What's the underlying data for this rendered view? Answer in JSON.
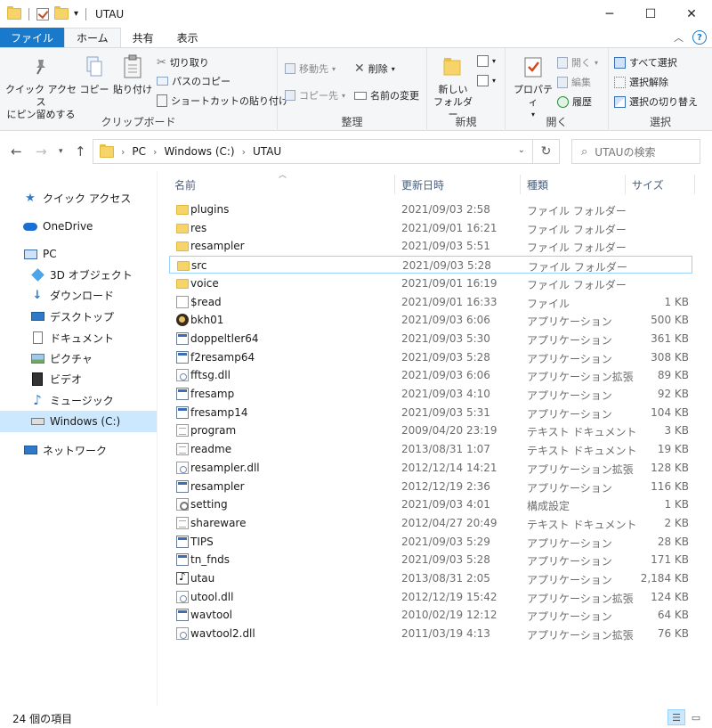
{
  "window": {
    "title": "UTAU"
  },
  "ribbon_tabs": [
    {
      "label": "ファイル"
    },
    {
      "label": "ホーム"
    },
    {
      "label": "共有"
    },
    {
      "label": "表示"
    }
  ],
  "ribbon": {
    "clipboard": {
      "label": "クリップボード",
      "pin": "クイック アクセス\nにピン留めする",
      "pin_line1": "クイック アクセス",
      "pin_line2": "にピン留めする",
      "copy": "コピー",
      "paste": "貼り付け",
      "cut": "切り取り",
      "copy_path": "パスのコピー",
      "paste_shortcut": "ショートカットの貼り付け"
    },
    "organize": {
      "label": "整理",
      "move_to": "移動先",
      "copy_to": "コピー先",
      "delete": "削除",
      "rename": "名前の変更"
    },
    "new": {
      "label": "新規",
      "new_folder_line1": "新しい",
      "new_folder_line2": "フォルダー"
    },
    "open": {
      "label": "開く",
      "properties": "プロパティ",
      "open": "開く",
      "edit": "編集",
      "history": "履歴"
    },
    "select": {
      "label": "選択",
      "select_all": "すべて選択",
      "select_none": "選択解除",
      "invert": "選択の切り替え"
    }
  },
  "address": {
    "crumbs": [
      "PC",
      "Windows (C:)",
      "UTAU"
    ]
  },
  "search": {
    "placeholder": "UTAUの検索"
  },
  "nav_pane": [
    {
      "label": "クイック アクセス",
      "icon": "star-icon"
    },
    {
      "label": "OneDrive",
      "icon": "cloud-icon"
    },
    {
      "label": "PC",
      "icon": "pc-icon"
    },
    {
      "label": "3D オブジェクト",
      "icon": "cube-icon"
    },
    {
      "label": "ダウンロード",
      "icon": "download-icon"
    },
    {
      "label": "デスクトップ",
      "icon": "desktop-icon"
    },
    {
      "label": "ドキュメント",
      "icon": "document-icon"
    },
    {
      "label": "ピクチャ",
      "icon": "picture-icon"
    },
    {
      "label": "ビデオ",
      "icon": "video-icon"
    },
    {
      "label": "ミュージック",
      "icon": "music-icon"
    },
    {
      "label": "Windows (C:)",
      "icon": "drive-icon"
    },
    {
      "label": "ネットワーク",
      "icon": "network-icon"
    }
  ],
  "columns": {
    "name": "名前",
    "date": "更新日時",
    "type": "種類",
    "size": "サイズ"
  },
  "files": [
    {
      "name": "plugins",
      "date": "2021/09/03 2:58",
      "type": "ファイル フォルダー",
      "size": "",
      "kind": "folder"
    },
    {
      "name": "res",
      "date": "2021/09/01 16:21",
      "type": "ファイル フォルダー",
      "size": "",
      "kind": "folder"
    },
    {
      "name": "resampler",
      "date": "2021/09/03 5:51",
      "type": "ファイル フォルダー",
      "size": "",
      "kind": "folder"
    },
    {
      "name": "src",
      "date": "2021/09/03 5:28",
      "type": "ファイル フォルダー",
      "size": "",
      "kind": "folder"
    },
    {
      "name": "voice",
      "date": "2021/09/01 16:19",
      "type": "ファイル フォルダー",
      "size": "",
      "kind": "folder"
    },
    {
      "name": "$read",
      "date": "2021/09/01 16:33",
      "type": "ファイル",
      "size": "1 KB",
      "kind": "file"
    },
    {
      "name": "bkh01",
      "date": "2021/09/03 6:06",
      "type": "アプリケーション",
      "size": "500 KB",
      "kind": "bkh"
    },
    {
      "name": "doppeltler64",
      "date": "2021/09/03 5:30",
      "type": "アプリケーション",
      "size": "361 KB",
      "kind": "app"
    },
    {
      "name": "f2resamp64",
      "date": "2021/09/03 5:28",
      "type": "アプリケーション",
      "size": "308 KB",
      "kind": "app"
    },
    {
      "name": "fftsg.dll",
      "date": "2021/09/03 6:06",
      "type": "アプリケーション拡張",
      "size": "89 KB",
      "kind": "dll"
    },
    {
      "name": "fresamp",
      "date": "2021/09/03 4:10",
      "type": "アプリケーション",
      "size": "92 KB",
      "kind": "app"
    },
    {
      "name": "fresamp14",
      "date": "2021/09/03 5:31",
      "type": "アプリケーション",
      "size": "104 KB",
      "kind": "app"
    },
    {
      "name": "program",
      "date": "2009/04/20 23:19",
      "type": "テキスト ドキュメント",
      "size": "3 KB",
      "kind": "txt"
    },
    {
      "name": "readme",
      "date": "2013/08/31 1:07",
      "type": "テキスト ドキュメント",
      "size": "19 KB",
      "kind": "txt"
    },
    {
      "name": "resampler.dll",
      "date": "2012/12/14 14:21",
      "type": "アプリケーション拡張",
      "size": "128 KB",
      "kind": "dll"
    },
    {
      "name": "resampler",
      "date": "2012/12/19 2:36",
      "type": "アプリケーション",
      "size": "116 KB",
      "kind": "app"
    },
    {
      "name": "setting",
      "date": "2021/09/03 4:01",
      "type": "構成設定",
      "size": "1 KB",
      "kind": "cfg"
    },
    {
      "name": "shareware",
      "date": "2012/04/27 20:49",
      "type": "テキスト ドキュメント",
      "size": "2 KB",
      "kind": "txt"
    },
    {
      "name": "TIPS",
      "date": "2021/09/03 5:29",
      "type": "アプリケーション",
      "size": "28 KB",
      "kind": "app"
    },
    {
      "name": "tn_fnds",
      "date": "2021/09/03 5:28",
      "type": "アプリケーション",
      "size": "171 KB",
      "kind": "app"
    },
    {
      "name": "utau",
      "date": "2013/08/31 2:05",
      "type": "アプリケーション",
      "size": "2,184 KB",
      "kind": "utau"
    },
    {
      "name": "utool.dll",
      "date": "2012/12/19 15:42",
      "type": "アプリケーション拡張",
      "size": "124 KB",
      "kind": "dll"
    },
    {
      "name": "wavtool",
      "date": "2010/02/19 12:12",
      "type": "アプリケーション",
      "size": "64 KB",
      "kind": "app"
    },
    {
      "name": "wavtool2.dll",
      "date": "2011/03/19 4:13",
      "type": "アプリケーション拡張",
      "size": "76 KB",
      "kind": "dll"
    }
  ],
  "focused_index": 3,
  "status": {
    "count": "24 個の項目"
  },
  "colors": {
    "file_tab": "#1979ca",
    "selection": "#cce8ff",
    "focus_border": "#99d1ff"
  }
}
